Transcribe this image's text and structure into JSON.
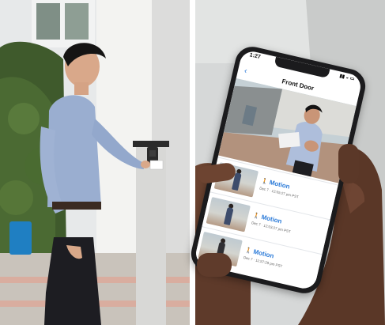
{
  "app": {
    "status_time": "1:27",
    "screen_title": "Front Door"
  },
  "events": [
    {
      "label": "Motion",
      "timestamp": "Dec 7 · 12:05:27 pm PST"
    },
    {
      "label": "Motion",
      "timestamp": "Dec 7 · 12:03:27 pm PST"
    },
    {
      "label": "Motion",
      "timestamp": "Dec 7 · 11:57:28 pm PST"
    }
  ],
  "colors": {
    "accent": "#2a7ad8",
    "pillar": "#d8d8d6",
    "reader": "#2b2b2b"
  },
  "icons": {
    "back": "chevron-left-icon",
    "motion": "walking-person-icon"
  }
}
